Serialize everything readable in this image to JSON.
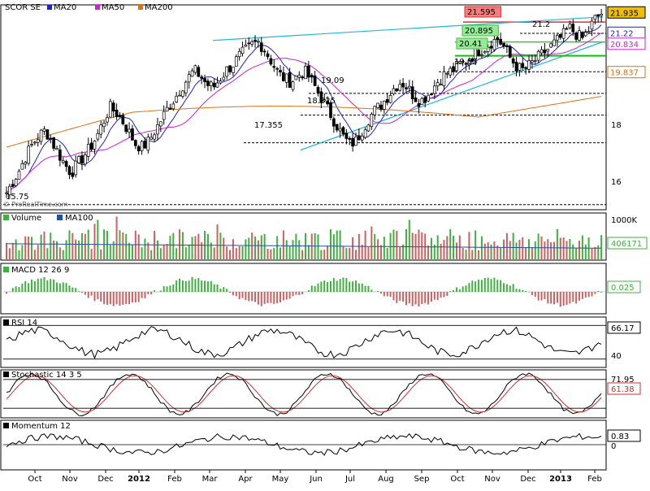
{
  "chart_data": [
    {
      "type": "candlestick",
      "title": "SCOR SE",
      "legend": [
        {
          "name": "MA20",
          "color": "#1f1fd0"
        },
        {
          "name": "MA50",
          "color": "#d020d0"
        },
        {
          "name": "MA200",
          "color": "#e07010"
        }
      ],
      "watermark": "© ProRealTime.com",
      "y_ticks": [
        "18",
        "16"
      ],
      "ylim": [
        15.0,
        22.2
      ],
      "price_levels": [
        {
          "label": "21.595",
          "value": 21.595,
          "box": true,
          "color": "#e03030"
        },
        {
          "label": "21.2",
          "value": 21.2
        },
        {
          "label": "20.895",
          "value": 20.895,
          "box": true,
          "color": "#40c040"
        },
        {
          "label": "20.41",
          "value": 20.41,
          "box": true,
          "color": "#40c040"
        },
        {
          "label": "19.85",
          "value": 19.85
        },
        {
          "label": "19.09",
          "value": 19.09
        },
        {
          "label": "18.325",
          "value": 18.325
        },
        {
          "label": "17.355",
          "value": 17.355
        },
        {
          "label": "15.75",
          "value": 15.18
        }
      ],
      "right_badges": [
        {
          "label": "21.935",
          "value": 21.935,
          "color": "#f0c000",
          "text_color": "#000000"
        },
        {
          "label": "21.22",
          "value": 21.22,
          "color": "#ffffff",
          "text_color": "#1f1fd0"
        },
        {
          "label": "20.834",
          "value": 20.834,
          "color": "#ffffff",
          "text_color": "#d020d0"
        },
        {
          "label": "19.837",
          "value": 19.837,
          "color": "#ffffff",
          "text_color": "#e07010"
        }
      ],
      "price_series": [
        15.6,
        16.0,
        16.4,
        16.9,
        17.3,
        17.6,
        17.8,
        17.4,
        17.0,
        16.6,
        16.3,
        16.6,
        16.9,
        17.2,
        17.6,
        18.1,
        18.6,
        18.4,
        18.1,
        17.7,
        17.3,
        17.2,
        17.4,
        17.8,
        18.2,
        18.6,
        18.9,
        19.3,
        19.6,
        19.9,
        19.7,
        19.4,
        19.3,
        19.6,
        19.9,
        20.1,
        20.4,
        20.6,
        20.8,
        20.9,
        20.6,
        20.2,
        19.8,
        19.6,
        19.5,
        19.7,
        19.9,
        19.6,
        19.2,
        18.8,
        18.4,
        18.0,
        17.6,
        17.3,
        17.4,
        17.8,
        18.2,
        18.5,
        18.7,
        19.0,
        19.3,
        19.5,
        19.3,
        19.0,
        18.8,
        19.0,
        19.3,
        19.6,
        19.8,
        19.9,
        20.1,
        20.2,
        20.4,
        20.6,
        20.7,
        20.9,
        21.0,
        20.7,
        20.3,
        20.0,
        19.9,
        20.1,
        20.3,
        20.5,
        20.7,
        20.9,
        21.1,
        21.4,
        21.2,
        21.0,
        21.3,
        21.7,
        21.9
      ]
    },
    {
      "type": "bar",
      "title": "Volume",
      "legend": [
        {
          "name": "Volume",
          "color": "#40b040"
        },
        {
          "name": "MA100",
          "color": "#2050a0"
        }
      ],
      "y_ticks": [
        "1000K"
      ],
      "last_value": "406171",
      "ylim": [
        0,
        1000000
      ]
    },
    {
      "type": "bar",
      "title": "MACD 12 26 9",
      "legend": [
        {
          "name": "MACD 12 26 9",
          "color": "#40b040"
        }
      ],
      "last_value": "0.025"
    },
    {
      "type": "line",
      "title": "RSI 14",
      "legend": [
        {
          "name": "RSI 14",
          "color": "#000000"
        }
      ],
      "y_ticks": [
        "40"
      ],
      "last_value": "66.17",
      "ylim": [
        20,
        80
      ]
    },
    {
      "type": "line",
      "title": "Stochastic 14 3 5",
      "legend": [
        {
          "name": "Stochastic 14 3 5",
          "color": "#000000"
        }
      ],
      "y_ticks": [
        "71.95"
      ],
      "last_value": "61.38",
      "ylim": [
        0,
        100
      ]
    },
    {
      "type": "line",
      "title": "Momentum 12",
      "legend": [
        {
          "name": "Momentum 12",
          "color": "#000000"
        }
      ],
      "y_ticks": [
        "0"
      ],
      "last_value": "0.83"
    }
  ],
  "x_axis": {
    "labels": [
      {
        "text": "Oct",
        "bold": false
      },
      {
        "text": "Nov",
        "bold": false
      },
      {
        "text": "Dec",
        "bold": false
      },
      {
        "text": "2012",
        "bold": true
      },
      {
        "text": "Feb",
        "bold": false
      },
      {
        "text": "Mar",
        "bold": false
      },
      {
        "text": "Apr",
        "bold": false
      },
      {
        "text": "May",
        "bold": false
      },
      {
        "text": "Jun",
        "bold": false
      },
      {
        "text": "Jul",
        "bold": false
      },
      {
        "text": "Aug",
        "bold": false
      },
      {
        "text": "Sep",
        "bold": false
      },
      {
        "text": "Oct",
        "bold": false
      },
      {
        "text": "Nov",
        "bold": false
      },
      {
        "text": "Dec",
        "bold": false
      },
      {
        "text": "2013",
        "bold": true
      },
      {
        "text": "Feb",
        "bold": false
      }
    ]
  }
}
